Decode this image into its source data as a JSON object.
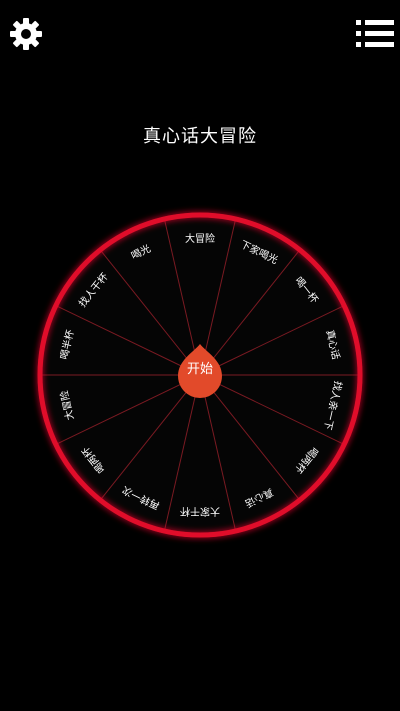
{
  "header": {
    "settings_icon": "gear-icon",
    "menu_icon": "list-icon"
  },
  "title": "真心话大冒险",
  "wheel": {
    "rim_color": "#e0102a",
    "segments": [
      "大冒险",
      "下家喝光",
      "喝一杯",
      "真心话",
      "找人亲一下",
      "喝两杯",
      "真心话",
      "大家干杯",
      "再转一次",
      "喝两杯",
      "大冒险",
      "喝半杯",
      "找人干杯",
      "喝光"
    ]
  },
  "spin": {
    "label": "开始",
    "color": "#e24a2a"
  }
}
